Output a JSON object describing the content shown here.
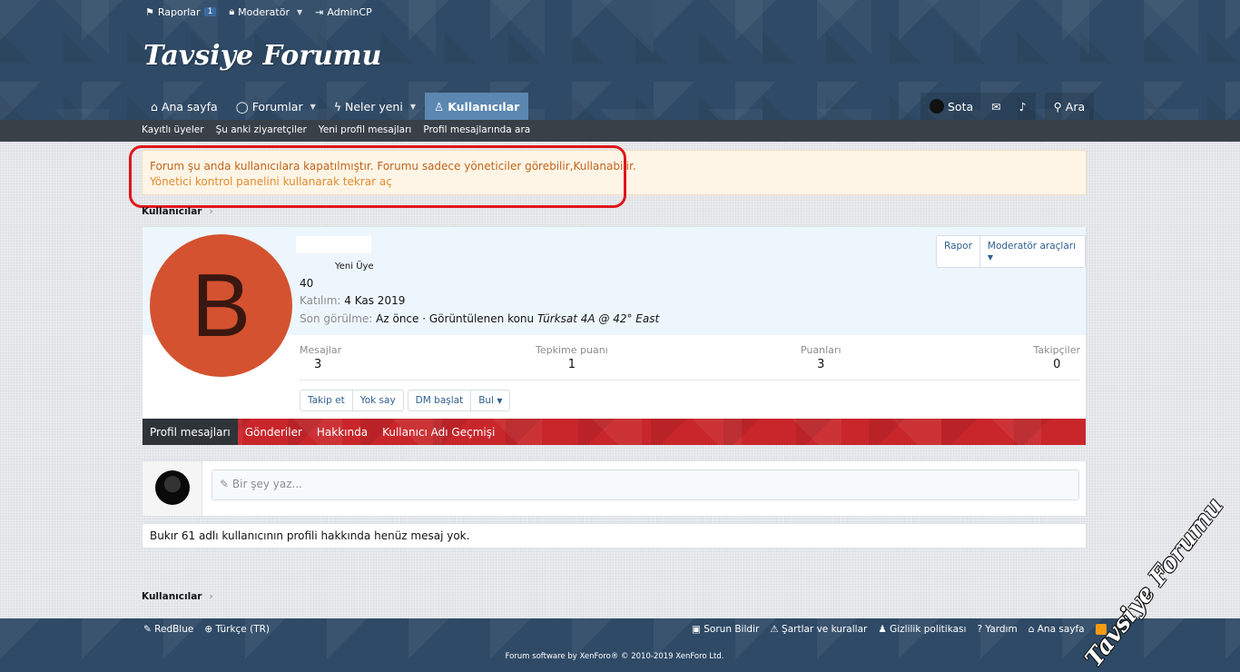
{
  "staffbar": {
    "reports_label": "Raporlar",
    "reports_count": "1",
    "moderator_label": "Moderatör",
    "admincp_label": "AdminCP"
  },
  "logo_text": "Tavsiye Forumu",
  "nav": {
    "home": "Ana sayfa",
    "forums": "Forumlar",
    "whats_new": "Neler yeni",
    "members": "Kullanıcılar",
    "user": "Sota",
    "search": "Ara"
  },
  "subnav": [
    "Kayıtlı üyeler",
    "Şu anki ziyaretçiler",
    "Yeni profil mesajları",
    "Profil mesajlarında ara"
  ],
  "notice": {
    "line1": "Forum şu anda kullanıcılara kapatılmıştır. Forumu sadece yöneticiler görebilir,Kullanabilir.",
    "line2": "Yönetici kontrol panelini kullanarak tekrar aç"
  },
  "breadcrumb": "Kullanıcılar",
  "profile": {
    "avatar_letter": "B",
    "user_title": "Yeni Üye",
    "message_count_line": "40",
    "joined_label": "Katılım:",
    "joined_value": "4 Kas 2019",
    "last_seen_label": "Son görülme:",
    "last_seen_value": "Az önce · Görüntülenen konu",
    "last_seen_thread": "Türksat 4A @ 42° East",
    "report_btn": "Rapor",
    "mod_tools_btn": "Moderatör araçları",
    "stats": [
      {
        "label": "Mesajlar",
        "value": "3"
      },
      {
        "label": "Tepkime puanı",
        "value": "1"
      },
      {
        "label": "Puanları",
        "value": "3"
      },
      {
        "label": "Takipçiler",
        "value": "0"
      }
    ],
    "follow_btn": "Takip et",
    "ignore_btn": "Yok say",
    "dm_btn": "DM başlat",
    "find_btn": "Bul",
    "tabs": [
      "Profil mesajları",
      "Gönderiler",
      "Hakkında",
      "Kullanıcı Adı Geçmişi"
    ]
  },
  "composer_placeholder": "Bir şey yaz...",
  "empty_message": "Bukır 61 adlı kullanıcının profili hakkında henüz mesaj yok.",
  "footer": {
    "style": "RedBlue",
    "language": "Türkçe (TR)",
    "links": [
      "Sorun Bildir",
      "Şartlar ve kurallar",
      "Gizlilik politikası",
      "Yardım",
      "Ana sayfa"
    ],
    "copyright": "Forum software by XenForo® © 2010-2019 XenForo Ltd."
  },
  "watermark_text": "Tavsiye Forumu",
  "colors": {
    "header": "#2f4a66",
    "tab_bar": "#c9262b",
    "notice_bg": "#fff5e6",
    "avatar": "#d4522f"
  }
}
